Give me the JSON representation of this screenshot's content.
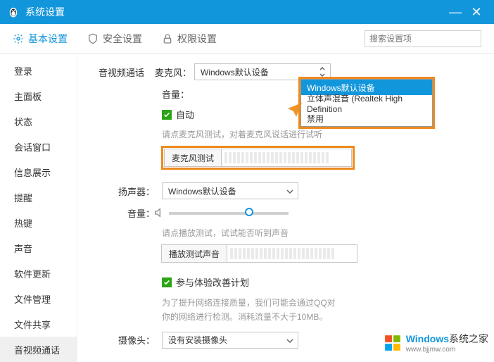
{
  "title": "系统设置",
  "tabs": {
    "basic": "基本设置",
    "security": "安全设置",
    "privilege": "权限设置"
  },
  "search_placeholder": "搜索设置项",
  "sidebar": {
    "items": [
      "登录",
      "主面板",
      "状态",
      "会话窗口",
      "信息展示",
      "提醒",
      "热键",
      "声音",
      "软件更新",
      "文件管理",
      "文件共享",
      "音视频通话"
    ]
  },
  "content": {
    "av_call": "音视频通话",
    "microphone_label": "麦克风：",
    "microphone_value": "Windows默认设备",
    "microphone_options": [
      "Windows默认设备",
      "立体声混音 (Realtek High Definition",
      "禁用"
    ],
    "volume": "音量：",
    "auto": "自动",
    "mic_hint": "请点麦克风测试，对着麦克风说话进行试听",
    "mic_test_btn": "麦克风测试",
    "speaker_label": "扬声器：",
    "speaker_value": "Windows默认设备",
    "speaker_hint": "请点播放测试，试试能否听到声音",
    "play_test_btn": "播放测试声音",
    "plan_label": "参与体验改善计划",
    "plan_text1": "为了提升网络连接质量，我们可能会通过QQ对",
    "plan_text2": "你的网络进行检测。消耗流量不大于10MB。",
    "camera_label": "摄像头：",
    "camera_value": "没有安装摄像头"
  },
  "watermark": {
    "brand1": "Windows",
    "brand2": "系统之家",
    "url": "www.bjjmw.com"
  }
}
